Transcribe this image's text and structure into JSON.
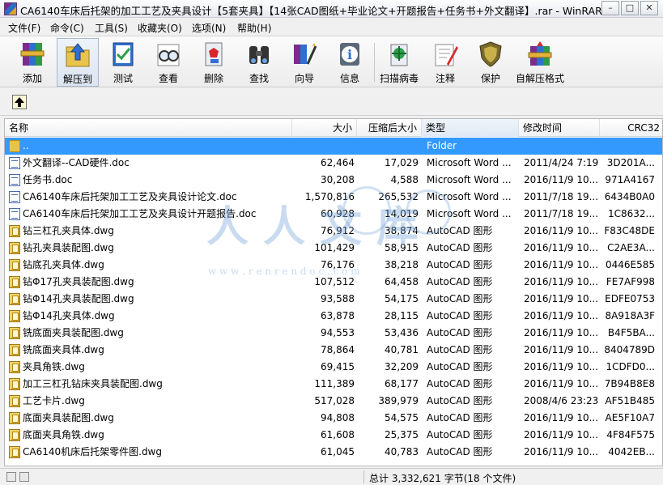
{
  "window": {
    "title": "CA6140车床后托架的加工工艺及夹具设计【5套夹具】【14张CAD图纸+毕业论文+开题报告+任务书+外文翻译】.rar - WinRAR",
    "minimize": "–",
    "maximize": "□",
    "close": "✕"
  },
  "menu": [
    "文件(F)",
    "命令(C)",
    "工具(S)",
    "收藏夹(O)",
    "选项(N)",
    "帮助(H)"
  ],
  "toolbar": {
    "add": "添加",
    "extract": "解压到",
    "test": "测试",
    "view": "查看",
    "delete": "删除",
    "find": "查找",
    "wizard": "向导",
    "info": "信息",
    "virus_scan": "扫描病毒",
    "comment": "注释",
    "protect": "保护",
    "sfx": "自解压格式"
  },
  "columns": {
    "name": "名称",
    "size": "大小",
    "packed": "压缩后大小",
    "type": "类型",
    "modified": "修改时间",
    "crc": "CRC32"
  },
  "files": [
    {
      "name": "..",
      "size": "",
      "packed": "",
      "type": "Folder",
      "modified": "",
      "crc": "",
      "icon": "folder"
    },
    {
      "name": "外文翻译--CAD硬件.doc",
      "size": "62,464",
      "packed": "17,029",
      "type": "Microsoft Word ...",
      "modified": "2011/4/24 7:19",
      "crc": "3D201A...",
      "icon": "doc"
    },
    {
      "name": "任务书.doc",
      "size": "30,208",
      "packed": "4,588",
      "type": "Microsoft Word ...",
      "modified": "2016/11/9 10...",
      "crc": "971A4167",
      "icon": "doc"
    },
    {
      "name": "CA6140车床后托架加工工艺及夹具设计论文.doc",
      "size": "1,570,816",
      "packed": "265,532",
      "type": "Microsoft Word ...",
      "modified": "2011/7/18 19...",
      "crc": "6434B0A0",
      "icon": "doc"
    },
    {
      "name": "CA6140车床后托架加工工艺及夹具设计开题报告.doc",
      "size": "60,928",
      "packed": "14,019",
      "type": "Microsoft Word ...",
      "modified": "2011/7/18 19...",
      "crc": "1C8632...",
      "icon": "doc"
    },
    {
      "name": "钻三杠孔夹具体.dwg",
      "size": "76,912",
      "packed": "38,874",
      "type": "AutoCAD 图形",
      "modified": "2016/11/9 10...",
      "crc": "F83C48DE",
      "icon": "dwg"
    },
    {
      "name": "钻孔夹具装配图.dwg",
      "size": "101,429",
      "packed": "58,915",
      "type": "AutoCAD 图形",
      "modified": "2016/11/9 10...",
      "crc": "C2AE3A...",
      "icon": "dwg"
    },
    {
      "name": "钻底孔夹具体.dwg",
      "size": "76,176",
      "packed": "38,218",
      "type": "AutoCAD 图形",
      "modified": "2016/11/9 10...",
      "crc": "0446E585",
      "icon": "dwg"
    },
    {
      "name": "钻Φ17孔夹具装配图.dwg",
      "size": "107,512",
      "packed": "64,458",
      "type": "AutoCAD 图形",
      "modified": "2016/11/9 10...",
      "crc": "FE7AF998",
      "icon": "dwg"
    },
    {
      "name": "钻Φ14孔夹具装配图.dwg",
      "size": "93,588",
      "packed": "54,175",
      "type": "AutoCAD 图形",
      "modified": "2016/11/9 10...",
      "crc": "EDFE0753",
      "icon": "dwg"
    },
    {
      "name": "钻Φ14孔夹具体.dwg",
      "size": "63,878",
      "packed": "28,115",
      "type": "AutoCAD 图形",
      "modified": "2016/11/9 10...",
      "crc": "8A918A3F",
      "icon": "dwg"
    },
    {
      "name": "铣底面夹具装配图.dwg",
      "size": "94,553",
      "packed": "53,436",
      "type": "AutoCAD 图形",
      "modified": "2016/11/9 10...",
      "crc": "B4F5BA...",
      "icon": "dwg"
    },
    {
      "name": "铣底面夹具体.dwg",
      "size": "78,864",
      "packed": "40,781",
      "type": "AutoCAD 图形",
      "modified": "2016/11/9 10...",
      "crc": "8404789D",
      "icon": "dwg"
    },
    {
      "name": "夹具角铁.dwg",
      "size": "69,415",
      "packed": "32,209",
      "type": "AutoCAD 图形",
      "modified": "2016/11/9 10...",
      "crc": "1CDFD0...",
      "icon": "dwg"
    },
    {
      "name": "加工三杠孔钻床夹具装配图.dwg",
      "size": "111,389",
      "packed": "68,177",
      "type": "AutoCAD 图形",
      "modified": "2016/11/9 10...",
      "crc": "7B94B8E8",
      "icon": "dwg"
    },
    {
      "name": "工艺卡片.dwg",
      "size": "517,028",
      "packed": "389,979",
      "type": "AutoCAD 图形",
      "modified": "2008/4/6 23:23",
      "crc": "AF51B485",
      "icon": "dwg"
    },
    {
      "name": "底面夹具装配图.dwg",
      "size": "94,808",
      "packed": "54,575",
      "type": "AutoCAD 图形",
      "modified": "2016/11/9 10...",
      "crc": "AE5F10A7",
      "icon": "dwg"
    },
    {
      "name": "底面夹具角铁.dwg",
      "size": "61,608",
      "packed": "25,375",
      "type": "AutoCAD 图形",
      "modified": "2016/11/9 10...",
      "crc": "4F84F575",
      "icon": "dwg"
    },
    {
      "name": "CA6140机床后托架零件图.dwg",
      "size": "61,045",
      "packed": "40,783",
      "type": "AutoCAD 图形",
      "modified": "2016/11/9 10...",
      "crc": "4042EB...",
      "icon": "dwg"
    }
  ],
  "status": {
    "summary": "总计 3,332,621 字节(18 个文件)"
  },
  "watermark": {
    "chars": "人人文库",
    "url": "w w w . r e n r e n d o c . c o m"
  }
}
